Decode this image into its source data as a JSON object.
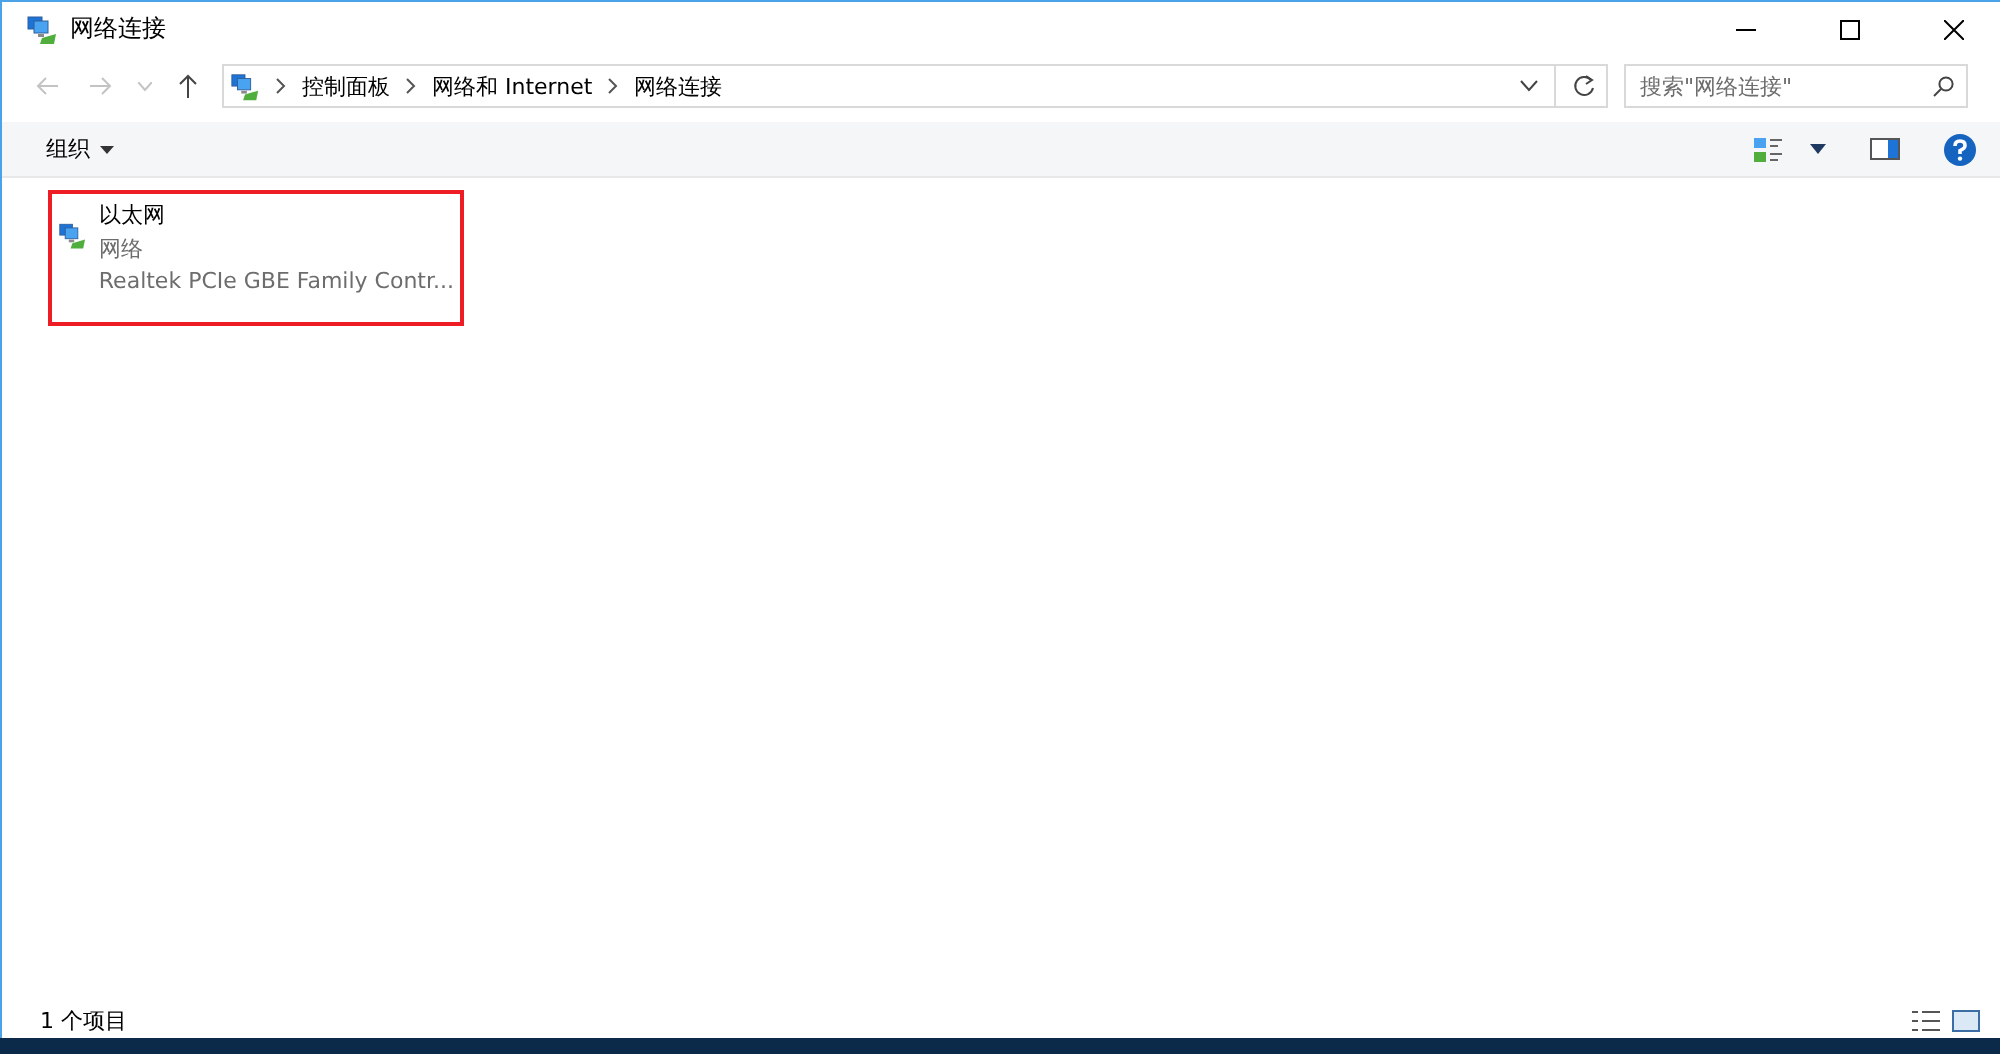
{
  "window": {
    "title": "网络连接"
  },
  "address_bar": {
    "breadcrumbs": [
      "控制面板",
      "网络和 Internet",
      "网络连接"
    ]
  },
  "search": {
    "placeholder": "搜索\"网络连接\""
  },
  "toolbar": {
    "organize": "组织"
  },
  "items": [
    {
      "name": "以太网",
      "status": "网络",
      "device": "Realtek PCIe GBE Family Contr...",
      "annotated": true
    }
  ],
  "status_bar": {
    "count": "1 个项目"
  }
}
